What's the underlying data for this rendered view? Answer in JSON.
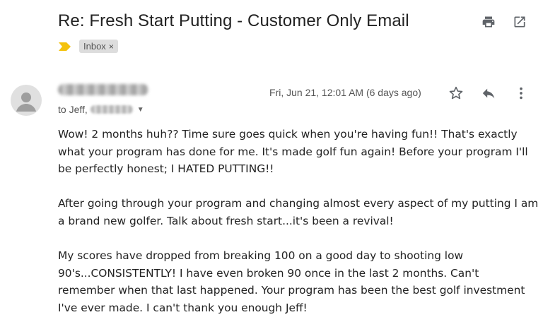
{
  "email": {
    "subject": "Re: Fresh Start Putting - Customer Only Email",
    "label": "Inbox",
    "label_remove": "×",
    "to_prefix": "to Jeff,",
    "timestamp": "Fri, Jun 21, 12:01 AM (6 days ago)",
    "body": [
      "Wow!  2 months huh??  Time sure goes quick when you're having fun!!  That's exactly what your program has done for me.  It's made golf fun again!  Before your program I'll be perfectly honest; I HATED PUTTING!!",
      "After going through your program and changing almost every aspect of my putting I am a brand new golfer.  Talk about fresh start...it's been a revival!",
      "My scores have dropped from breaking 100 on a good day to shooting low 90's...CONSISTENTLY!    I have even broken 90 once in the last 2 months.  Can't remember when that last happened.   Your program has been the best golf investment I've ever made.  I can't thank you enough Jeff!"
    ]
  },
  "icons": {
    "print": "print-icon",
    "open_new_window": "open-in-new-window-icon",
    "importance": "importance-marker-icon",
    "avatar": "person-icon",
    "star": "star-icon",
    "reply": "reply-icon",
    "more": "more-vertical-icon",
    "caret": "chevron-down-icon"
  },
  "colors": {
    "importance_marker": "#f4c20d",
    "chip_background": "#dddddd",
    "icon_gray": "#5f6368"
  }
}
